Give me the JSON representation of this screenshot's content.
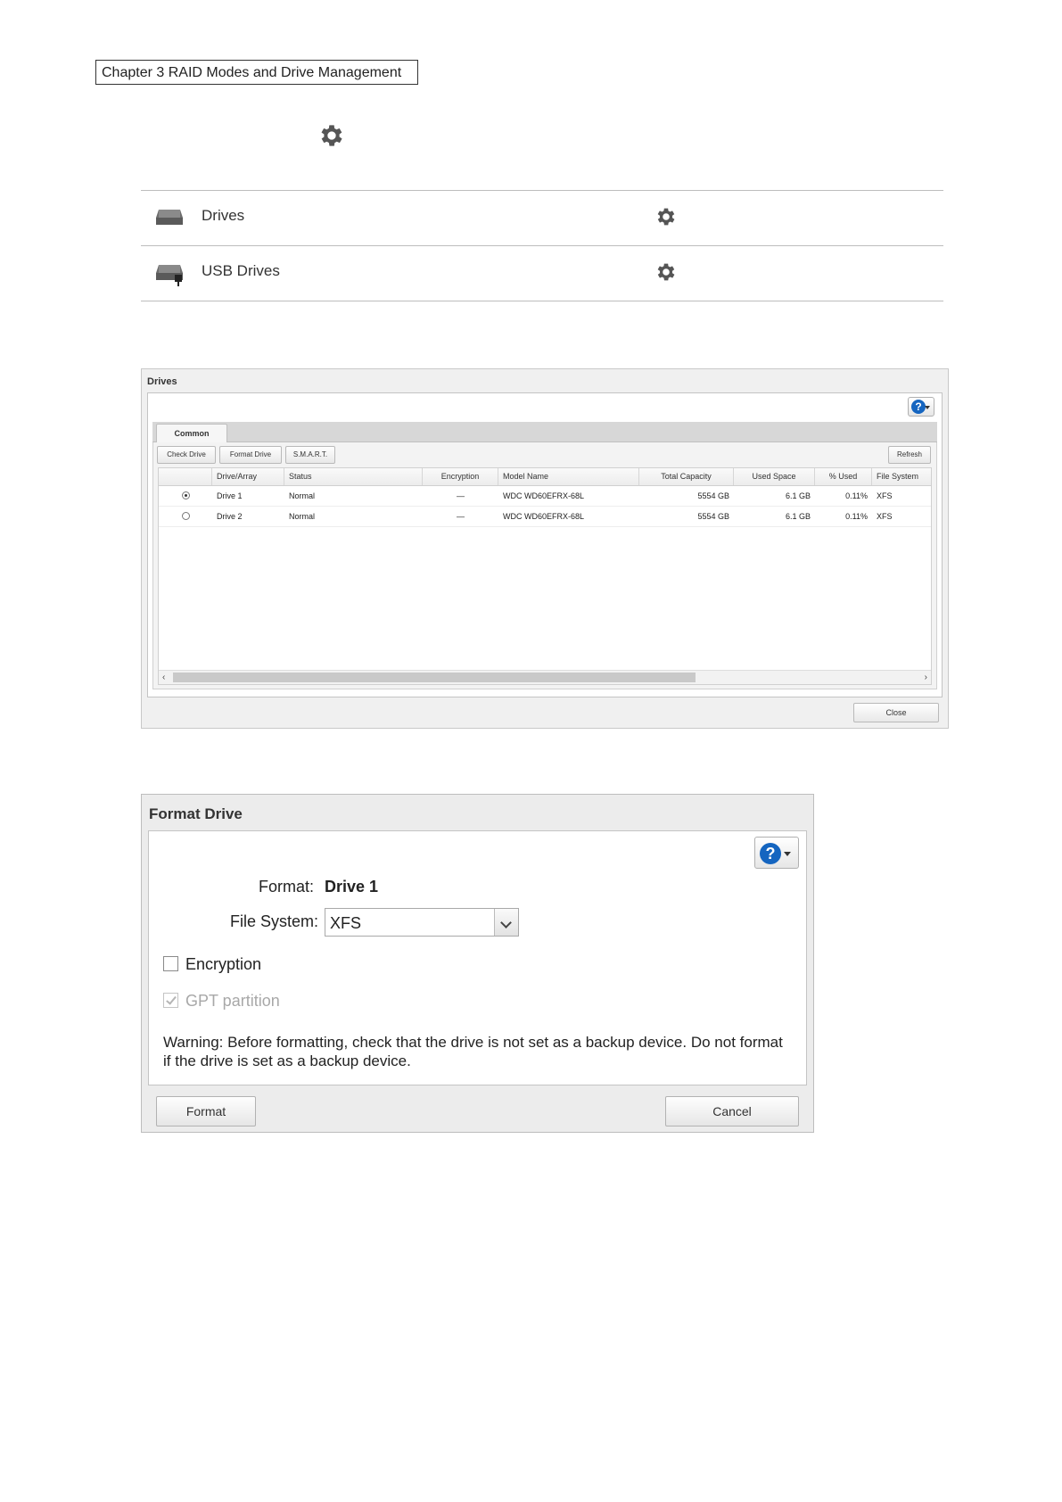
{
  "header": {
    "chapter": "Chapter 3 RAID Modes and Drive Management"
  },
  "settings_list": {
    "items": [
      {
        "label": "Drives",
        "icon": "hard-drive-icon"
      },
      {
        "label": "USB Drives",
        "icon": "usb-drive-icon"
      }
    ]
  },
  "drives_window": {
    "title": "Drives",
    "tab": "Common",
    "buttons": {
      "check": "Check Drive",
      "format": "Format Drive",
      "smart": "S.M.A.R.T.",
      "refresh": "Refresh",
      "close": "Close"
    },
    "columns": [
      "Drive/Array",
      "Status",
      "Encryption",
      "Model Name",
      "Total Capacity",
      "Used Space",
      "% Used",
      "File System"
    ],
    "rows": [
      {
        "selected": true,
        "drive": "Drive 1",
        "status": "Normal",
        "encryption": "—",
        "model": "WDC WD60EFRX-68L",
        "capacity": "5554 GB",
        "used": "6.1 GB",
        "pct": "0.11%",
        "fs": "XFS"
      },
      {
        "selected": false,
        "drive": "Drive 2",
        "status": "Normal",
        "encryption": "—",
        "model": "WDC WD60EFRX-68L",
        "capacity": "5554 GB",
        "used": "6.1 GB",
        "pct": "0.11%",
        "fs": "XFS"
      }
    ]
  },
  "format_dialog": {
    "title": "Format Drive",
    "format_label": "Format:",
    "format_value": "Drive 1",
    "fs_label": "File System:",
    "fs_value": "XFS",
    "encryption_label": "Encryption",
    "encryption_checked": false,
    "gpt_label": "GPT partition",
    "gpt_checked": true,
    "warning": "Warning: Before formatting, check that the drive is not set as a backup device. Do not format if the drive is set as a backup device.",
    "format_button": "Format",
    "cancel_button": "Cancel"
  },
  "colors": {
    "help_blue": "#1565c0",
    "gear_gray": "#555555"
  }
}
